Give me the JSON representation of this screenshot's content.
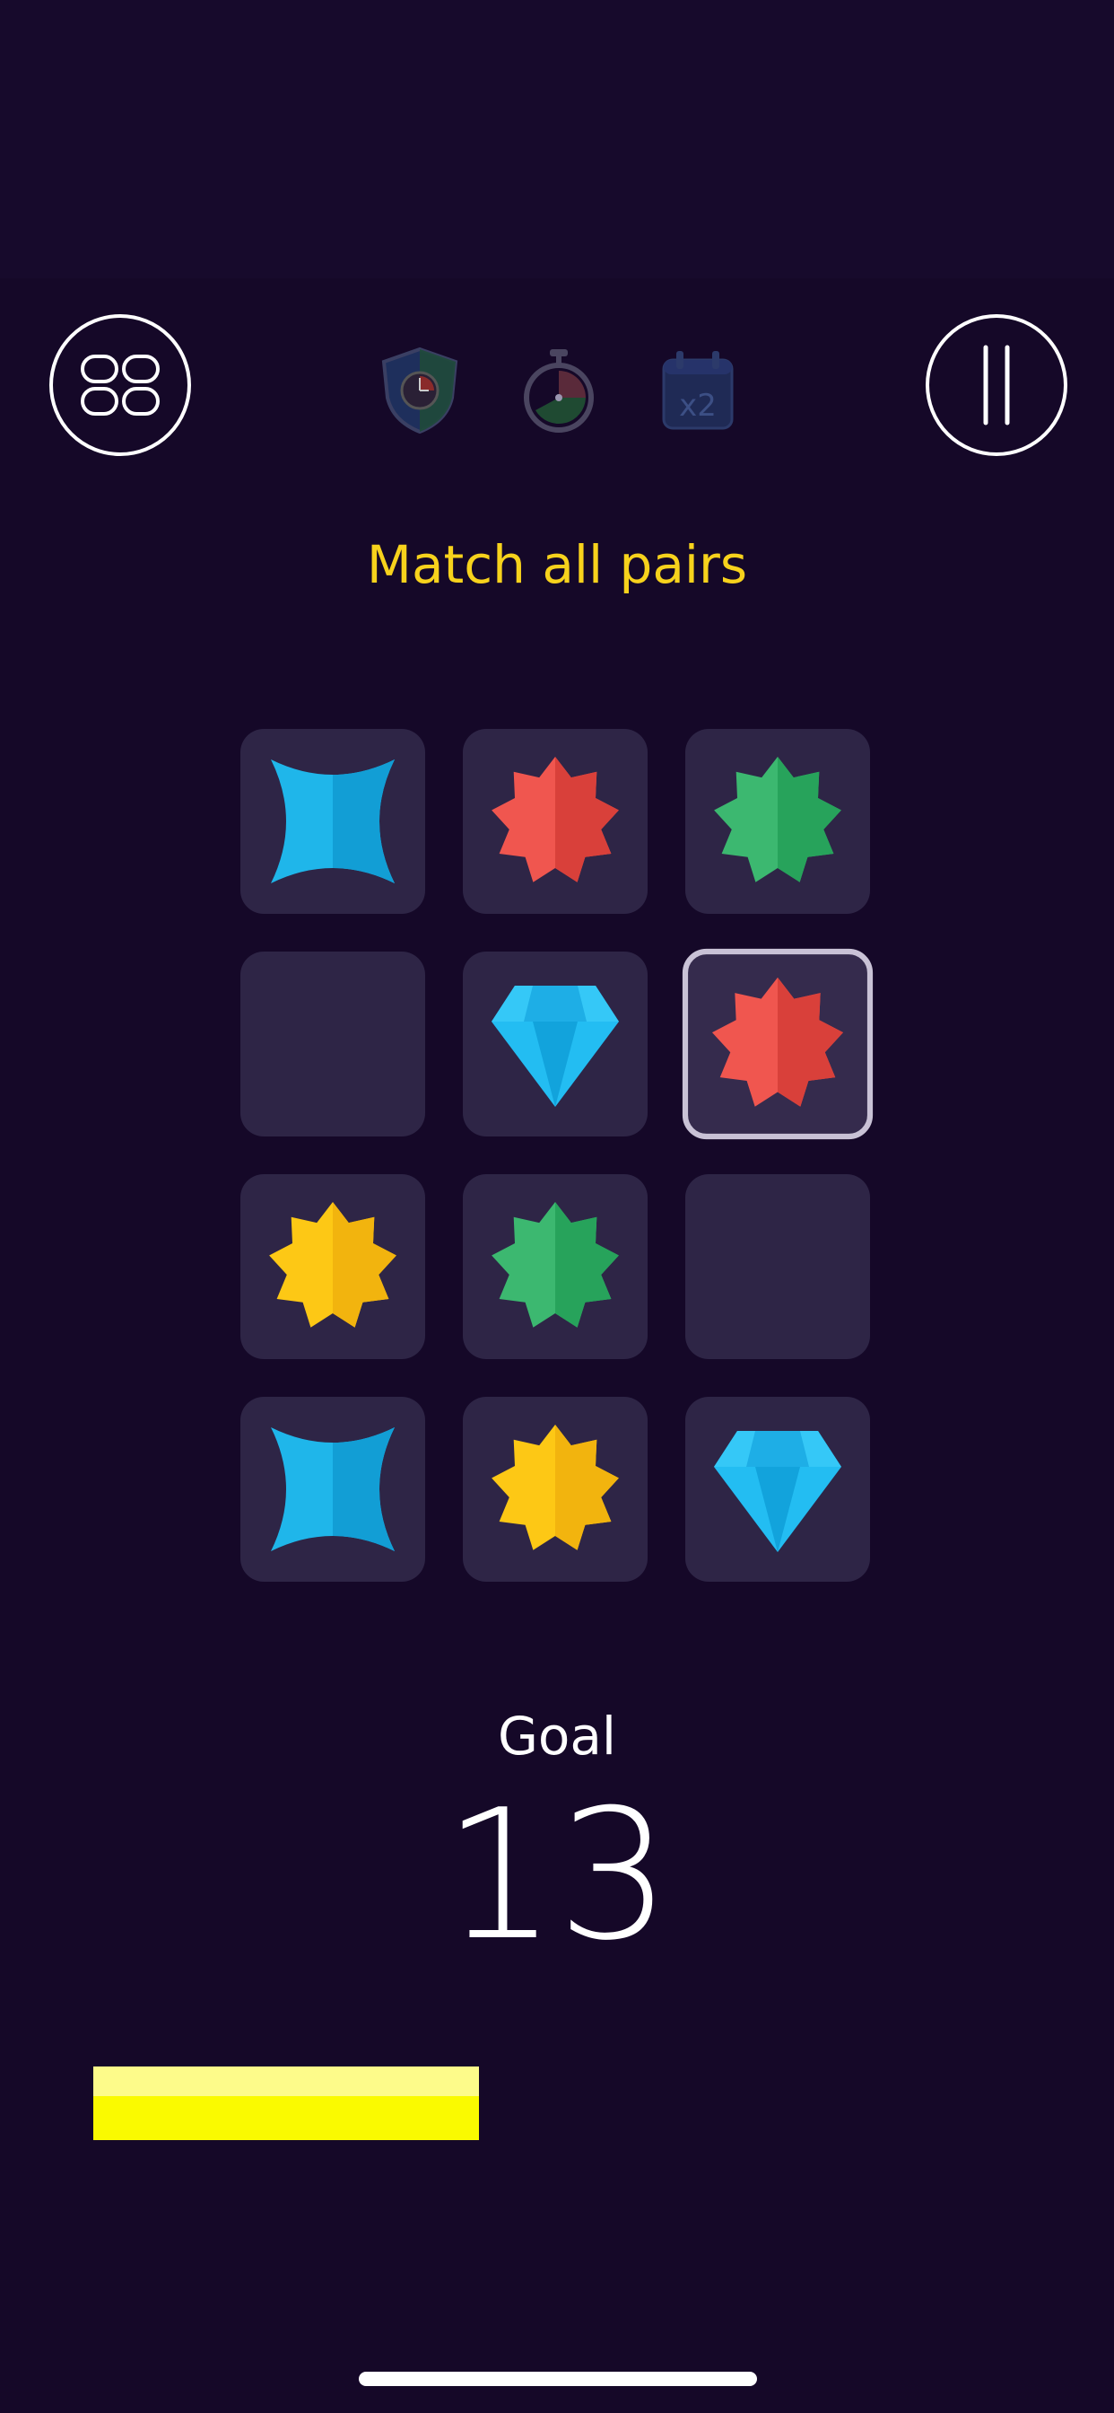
{
  "header": {
    "menu_icon": "grid-four-icon",
    "pause_icon": "pause-icon",
    "powerups": [
      {
        "icon": "shield-clock-icon"
      },
      {
        "icon": "stopwatch-icon"
      },
      {
        "icon": "calendar-x2-icon",
        "label": "x2"
      }
    ]
  },
  "instruction": "Match all pairs",
  "board": {
    "rows": 4,
    "cols": 3,
    "tiles": [
      {
        "gem": "blue-star"
      },
      {
        "gem": "red-burst"
      },
      {
        "gem": "green-burst"
      },
      {
        "gem": "empty"
      },
      {
        "gem": "blue-diamond"
      },
      {
        "gem": "red-burst",
        "selected": true
      },
      {
        "gem": "yellow-burst"
      },
      {
        "gem": "green-burst"
      },
      {
        "gem": "empty"
      },
      {
        "gem": "blue-star"
      },
      {
        "gem": "yellow-burst"
      },
      {
        "gem": "blue-diamond"
      }
    ]
  },
  "goal": {
    "label": "Goal",
    "value": "13",
    "progress_fraction": 0.34
  },
  "colors": {
    "background": "#150828",
    "instruction": "#f7d21c",
    "tile": "#2e2546",
    "progress": "#fafa00"
  }
}
